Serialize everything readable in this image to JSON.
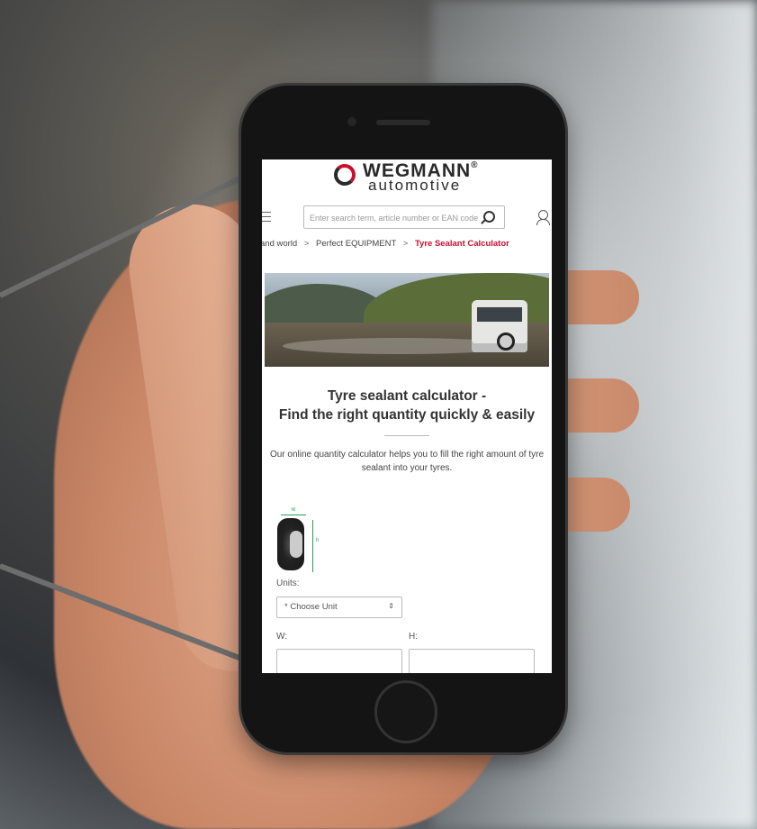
{
  "brand": {
    "name": "WEGMANN",
    "registered_mark": "®",
    "subtitle": "automotive",
    "accent_color": "#c8102e"
  },
  "header": {
    "search_placeholder": "Enter search term, article number or EAN code"
  },
  "breadcrumb": {
    "items": [
      "and world",
      "Perfect EQUIPMENT",
      "Tyre Sealant Calculator"
    ],
    "separator": ">"
  },
  "hero": {
    "image": "off-road vehicle on muddy mountain road"
  },
  "page": {
    "title_line1": "Tyre sealant calculator -",
    "title_line2": "Find the right quantity quickly & easily",
    "intro": "Our online quantity calculator helps you to fill the right amount of tyre sealant into your tyres."
  },
  "diagram": {
    "w_label": "W",
    "h_label": "h"
  },
  "form": {
    "units_label": "Units:",
    "unit_select_value": "* Choose Unit",
    "w_label": "W:",
    "h_label": "H:"
  }
}
